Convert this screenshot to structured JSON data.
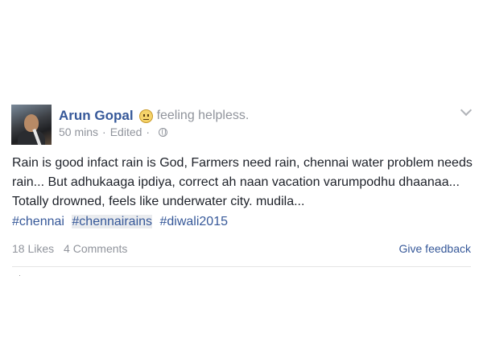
{
  "post": {
    "author": "Arun Gopal",
    "feeling": "feeling helpless.",
    "feeling_icon": "confused-face-icon",
    "time": "50 mins",
    "edited": "Edited",
    "separator": "·",
    "privacy_icon": "globe-icon",
    "message": "Rain is good infact rain is God, Farmers need rain, chennai water problem needs rain... But adhukaaga ipdiya, correct ah naan vacation varumpodhu dhaanaa... Totally drowned, feels like underwater city. mudila...",
    "hashtags": [
      "#chennai",
      "#chennairains",
      "#diwali2015"
    ],
    "likes": "18 Likes",
    "comments": "4 Comments",
    "give_feedback": "Give feedback"
  },
  "colors": {
    "link_blue": "#365899",
    "meta_gray": "#90949c",
    "text": "#1d2129"
  }
}
